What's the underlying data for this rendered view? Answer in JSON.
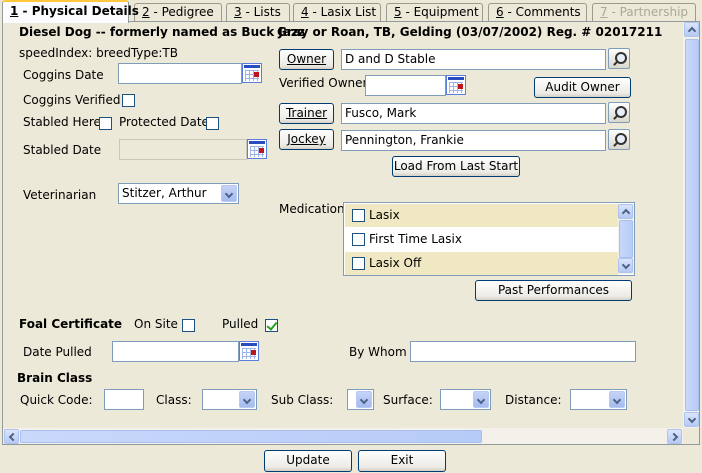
{
  "tabs": [
    {
      "key": "1",
      "label": " - Physical Details",
      "active": true
    },
    {
      "key": "2",
      "label": " - Pedigree"
    },
    {
      "key": "3",
      "label": " - Lists"
    },
    {
      "key": "4",
      "label": " - Lasix List"
    },
    {
      "key": "5",
      "label": " - Equipment"
    },
    {
      "key": "6",
      "label": " - Comments"
    },
    {
      "key": "7",
      "label": " - Partnership",
      "disabled": true
    }
  ],
  "header": {
    "horse": "Diesel Dog --  formerly named as Buck Jazz",
    "details": "Gray or Roan, TB, Gelding (03/07/2002) Reg. # 02017211",
    "speed_index": "speedIndex: breedType:TB"
  },
  "left": {
    "coggins_date_label": "Coggins Date",
    "coggins_verified_label": "Coggins Verified",
    "stabled_here_label": "Stabled Here",
    "protected_date_label": "Protected Date",
    "stabled_date_label": "Stabled Date",
    "veterinarian_label": "Veterinarian",
    "veterinarian_value": "Stitzer, Arthur"
  },
  "right": {
    "owner_button": "Owner",
    "owner_value": "D and D Stable",
    "verified_owner_label": "Verified Owner",
    "audit_owner_button": "Audit Owner",
    "trainer_button": "Trainer",
    "trainer_value": "Fusco, Mark",
    "jockey_button": "Jockey",
    "jockey_value": "Pennington, Frankie",
    "load_last_start_button": "Load From Last Start",
    "medication_label": "Medication",
    "medications": [
      "Lasix",
      "First Time Lasix",
      "Lasix Off"
    ],
    "past_performances_button": "Past Performances"
  },
  "foal": {
    "title": "Foal Certificate",
    "on_site_label": "On Site",
    "pulled_label": "Pulled",
    "pulled_checked": true,
    "date_pulled_label": "Date Pulled",
    "by_whom_label": "By Whom"
  },
  "brain": {
    "title": "Brain Class",
    "quick_code_label": "Quick Code:",
    "class_label": "Class:",
    "sub_class_label": "Sub Class:",
    "surface_label": "Surface:",
    "distance_label": "Distance:"
  },
  "footer": {
    "update_button": "Update",
    "exit_button": "Exit"
  }
}
